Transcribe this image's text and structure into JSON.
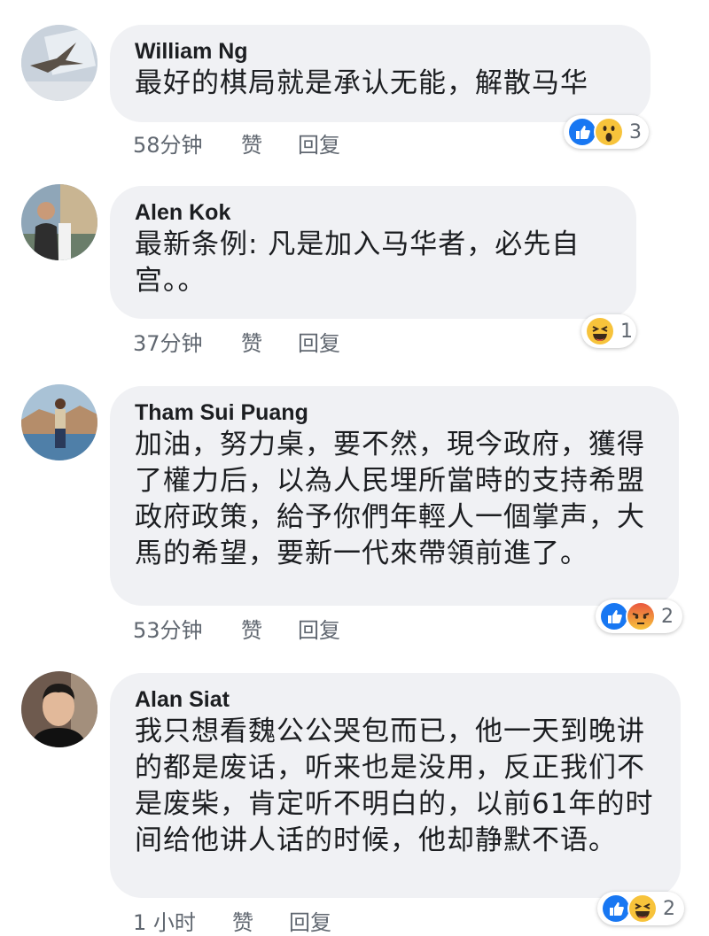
{
  "comments": [
    {
      "name": "William Ng",
      "text": "最好的棋局就是承认无能，解散马华",
      "time": "58分钟",
      "like": "赞",
      "reply": "回复",
      "reactions": [
        "like-icon",
        "wow-icon"
      ],
      "reaction_count": "3"
    },
    {
      "name": "Alen Kok",
      "text": "最新条例: 凡是加入马华者，必先自宫。。",
      "time": "37分钟",
      "like": "赞",
      "reply": "回复",
      "reactions": [
        "haha-icon"
      ],
      "reaction_count": "1"
    },
    {
      "name": "Tham Sui Puang",
      "text": "加油，努力桌，要不然，現今政府，獲得了權力后，以為人民埋所當時的支持希盟政府政策，給予你們年輕人一個掌声，大馬的希望，要新一代來帶領前進了。",
      "time": "53分钟",
      "like": "赞",
      "reply": "回复",
      "reactions": [
        "like-icon",
        "angry-icon"
      ],
      "reaction_count": "2"
    },
    {
      "name": "Alan Siat",
      "text": "我只想看魏公公哭包而已，他一天到晚讲的都是废话，听来也是没用，反正我们不是废柴，肯定听不明白的，以前61年的时间给他讲人话的时候，他却静默不语。",
      "time": "1 小时",
      "like": "赞",
      "reply": "回复",
      "reactions": [
        "like-icon",
        "haha-icon"
      ],
      "reaction_count": "2"
    }
  ],
  "colors": {
    "bubble": "#f0f1f4",
    "meta_text": "#606770",
    "like_blue": "#1877f2",
    "emoji_yellow": "#f7c33b",
    "angry_red": "#e9573f"
  }
}
